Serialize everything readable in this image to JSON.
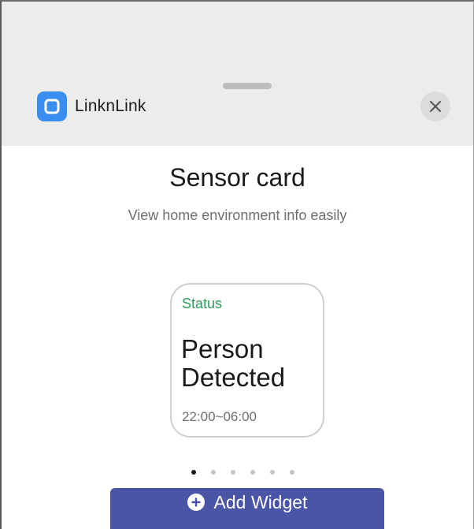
{
  "header": {
    "app_name": "LinknLink",
    "logo_icon": "linknlink-logo-icon",
    "close_icon": "close-icon"
  },
  "main": {
    "title": "Sensor card",
    "subtitle": "View home environment info easily"
  },
  "card": {
    "label": "Status",
    "value": "Person Detected",
    "time_range": "22:00~06:00",
    "label_color": "#2e9c5a"
  },
  "pager": {
    "count": 6,
    "active_index": 0
  },
  "footer": {
    "add_button_label": "Add Widget",
    "add_icon": "plus-circle-icon",
    "button_color": "#4a55a6"
  }
}
